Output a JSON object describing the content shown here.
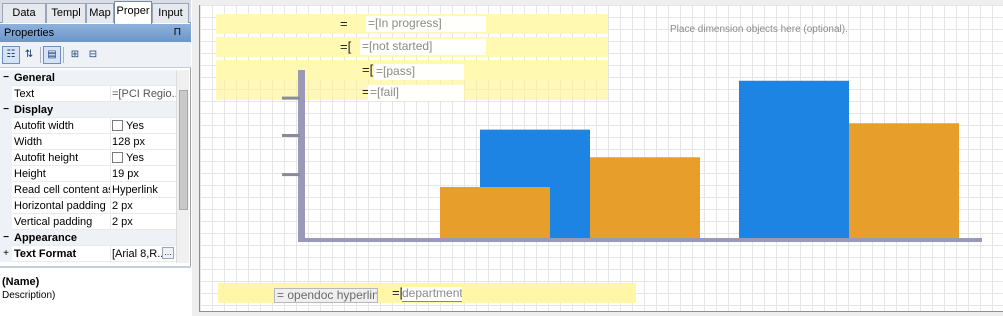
{
  "left_panel": {
    "tabs": [
      "Data",
      "Templ",
      "Map",
      "Proper",
      "Input"
    ],
    "active_tab": "Proper",
    "properties_title": "Properties",
    "pin_glyph": "Π",
    "toolbar_icons": [
      "categorized-icon",
      "alphabetical-icon",
      "property-pages-icon",
      "expand-all-icon",
      "collapse-all-icon"
    ],
    "rows": [
      {
        "type": "category",
        "name": "General",
        "glyph": "−"
      },
      {
        "type": "prop",
        "name": "Text",
        "value": "=[PCI Regio..."
      },
      {
        "type": "category",
        "name": "Display",
        "glyph": "−"
      },
      {
        "type": "prop",
        "name": "Autofit width",
        "value": "Yes",
        "checkbox": true
      },
      {
        "type": "prop",
        "name": "Width",
        "value": "128 px"
      },
      {
        "type": "prop",
        "name": "Autofit height",
        "value": "Yes",
        "checkbox": true
      },
      {
        "type": "prop",
        "name": "Height",
        "value": "19 px"
      },
      {
        "type": "prop",
        "name": "Read cell content as",
        "value": "Hyperlink"
      },
      {
        "type": "prop",
        "name": "Horizontal padding",
        "value": "2 px"
      },
      {
        "type": "prop",
        "name": "Vertical padding",
        "value": "2 px"
      },
      {
        "type": "category",
        "name": "Appearance",
        "glyph": "−"
      },
      {
        "type": "category",
        "name": "Text Format",
        "glyph": "+",
        "value": "[Arial 8,R..."
      }
    ],
    "description_name": "(Name)",
    "description_text": "Description)"
  },
  "canvas": {
    "placeholder_hint": "Place dimension objects here (optional).",
    "legend_fields": [
      {
        "prefix": "=",
        "label": "=[In progress]"
      },
      {
        "prefix": "=[",
        "label": "=[not started]"
      },
      {
        "prefix": "=[",
        "label": "=[pass]"
      },
      {
        "prefix": "=",
        "label": "=[fail]"
      }
    ],
    "bottom_hyperlink": "= opendoc hyperlink",
    "bottom_field_prefix": "=[",
    "bottom_field": "department]"
  },
  "chart_data": {
    "type": "bar",
    "categories": [
      "",
      "",
      ""
    ],
    "series": [
      {
        "values": [
          0,
          102,
          148
        ],
        "color": "#1e84e3"
      },
      {
        "values": [
          48,
          76,
          108
        ],
        "color": "#e79e2b"
      }
    ],
    "ylim": [
      0,
      160
    ],
    "title": "",
    "xlabel": "",
    "ylabel": "",
    "grid": false,
    "axis_color": "#9a9ab8"
  }
}
